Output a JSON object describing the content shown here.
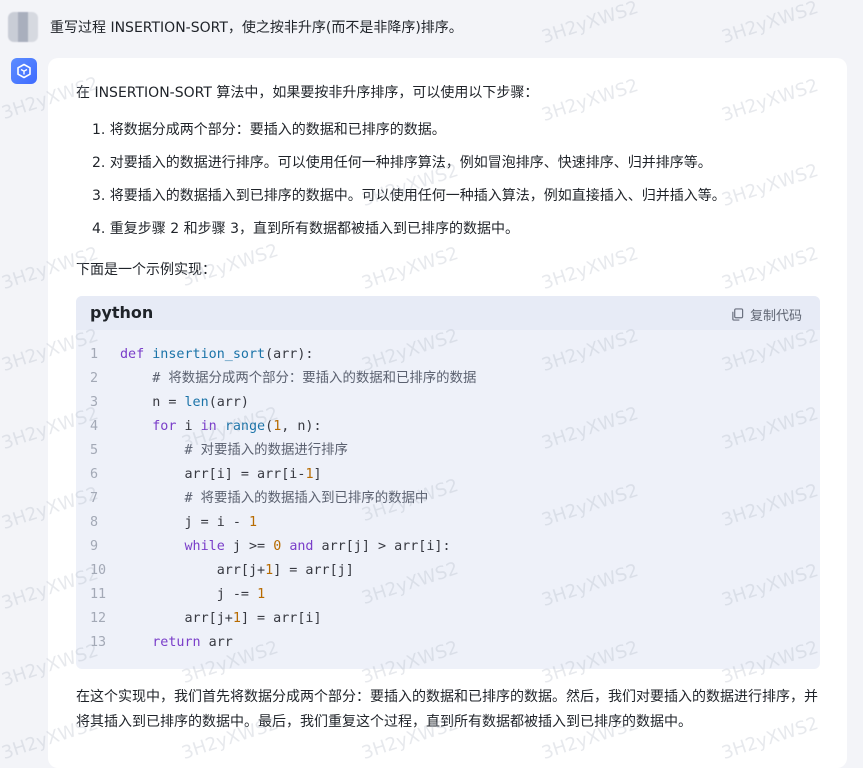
{
  "user_message": {
    "text": "重写过程 INSERTION-SORT，使之按非升序(而不是非降序)排序。"
  },
  "answer": {
    "intro": "在 INSERTION-SORT 算法中，如果要按非升序排序，可以使用以下步骤：",
    "steps": [
      "1. 将数据分成两个部分：要插入的数据和已排序的数据。",
      "2. 对要插入的数据进行排序。可以使用任何一种排序算法，例如冒泡排序、快速排序、归并排序等。",
      "3. 将要插入的数据插入到已排序的数据中。可以使用任何一种插入算法，例如直接插入、归并插入等。",
      "4. 重复步骤 2 和步骤 3，直到所有数据都被插入到已排序的数据中。"
    ],
    "example_label": "下面是一个示例实现：",
    "code_block": {
      "language": "python",
      "copy_label": "复制代码",
      "line_numbers": [
        "1",
        "2",
        "3",
        "4",
        "5",
        "6",
        "7",
        "8",
        "9",
        "10",
        "11",
        "12",
        "13"
      ]
    },
    "summary": "在这个实现中，我们首先将数据分成两个部分：要插入的数据和已排序的数据。然后，我们对要插入的数据进行排序，并将其插入到已排序的数据中。最后，我们重复这个过程，直到所有数据都被插入到已排序的数据中。"
  },
  "code_tokens": {
    "l1": [
      "def",
      "insertion_sort",
      "(arr):"
    ],
    "l2": [
      "# 将数据分成两个部分：要插入的数据和已排序的数据"
    ],
    "l3": [
      "n = ",
      "len",
      "(arr)"
    ],
    "l4": [
      "for",
      " i ",
      "in",
      " ",
      "range",
      "(",
      "1",
      ", n):"
    ],
    "l5": [
      "# 对要插入的数据进行排序"
    ],
    "l6": [
      "arr[i] = arr[i-",
      "1",
      "]"
    ],
    "l7": [
      "# 将要插入的数据插入到已排序的数据中"
    ],
    "l8": [
      "j = i - ",
      "1"
    ],
    "l9": [
      "while",
      " j >= ",
      "0",
      " ",
      "and",
      " arr[j] > arr[i]:"
    ],
    "l10": [
      "arr[j+",
      "1",
      "] = arr[j]"
    ],
    "l11": [
      "j -= ",
      "1"
    ],
    "l12": [
      "arr[j+",
      "1",
      "] = arr[i]"
    ],
    "l13": [
      "return",
      " arr"
    ]
  },
  "watermark": {
    "text": "3H2yXWS2"
  },
  "icons": {
    "bot_avatar": "cube-logo-icon",
    "copy": "copy-icon"
  },
  "colors": {
    "accent": "#3f6bff",
    "code_bg": "#eef1f9",
    "keyword": "#7a3ec9",
    "number": "#b76b01"
  }
}
